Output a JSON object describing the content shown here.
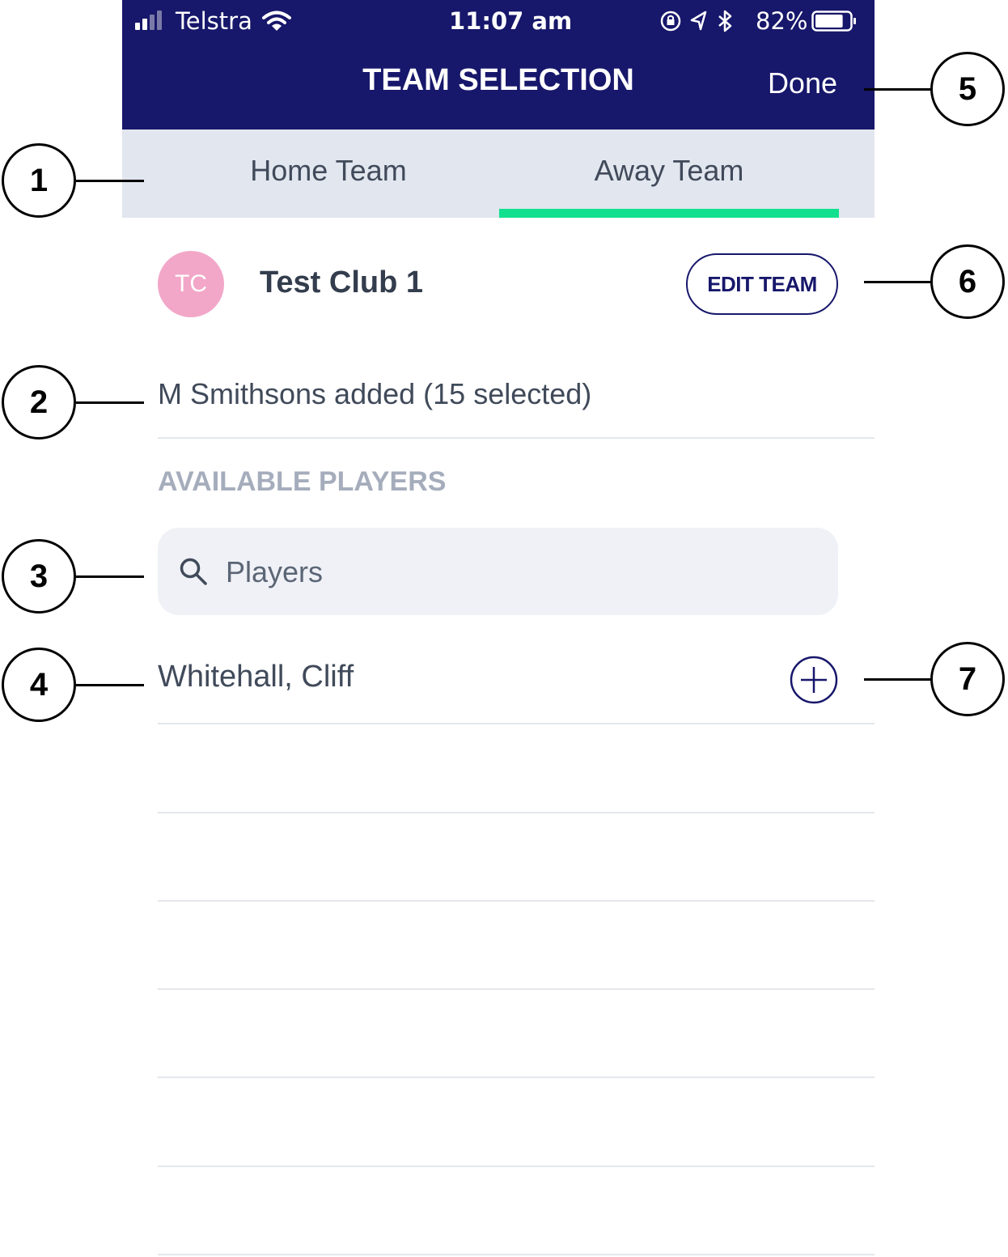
{
  "status_bar": {
    "carrier": "Telstra",
    "time": "11:07 am",
    "battery": "82%",
    "battery_level": 0.82
  },
  "nav": {
    "title": "TEAM SELECTION",
    "done_label": "Done"
  },
  "tabs": [
    {
      "label": "Home Team",
      "active": false
    },
    {
      "label": "Away Team",
      "active": true
    }
  ],
  "team": {
    "initials": "TC",
    "name": "Test Club 1",
    "edit_label": "EDIT TEAM",
    "avatar_color": "#f2a7c8"
  },
  "selection_status": "M Smithsons added (15 selected)",
  "available": {
    "heading": "AVAILABLE PLAYERS",
    "search_placeholder": "Players",
    "players": [
      {
        "name": "Whitehall, Cliff"
      }
    ]
  },
  "callouts": [
    "1",
    "2",
    "3",
    "4",
    "5",
    "6",
    "7"
  ],
  "colors": {
    "navy": "#17176b",
    "accent": "#12e08f",
    "tab_bg": "#e2e6ee"
  }
}
